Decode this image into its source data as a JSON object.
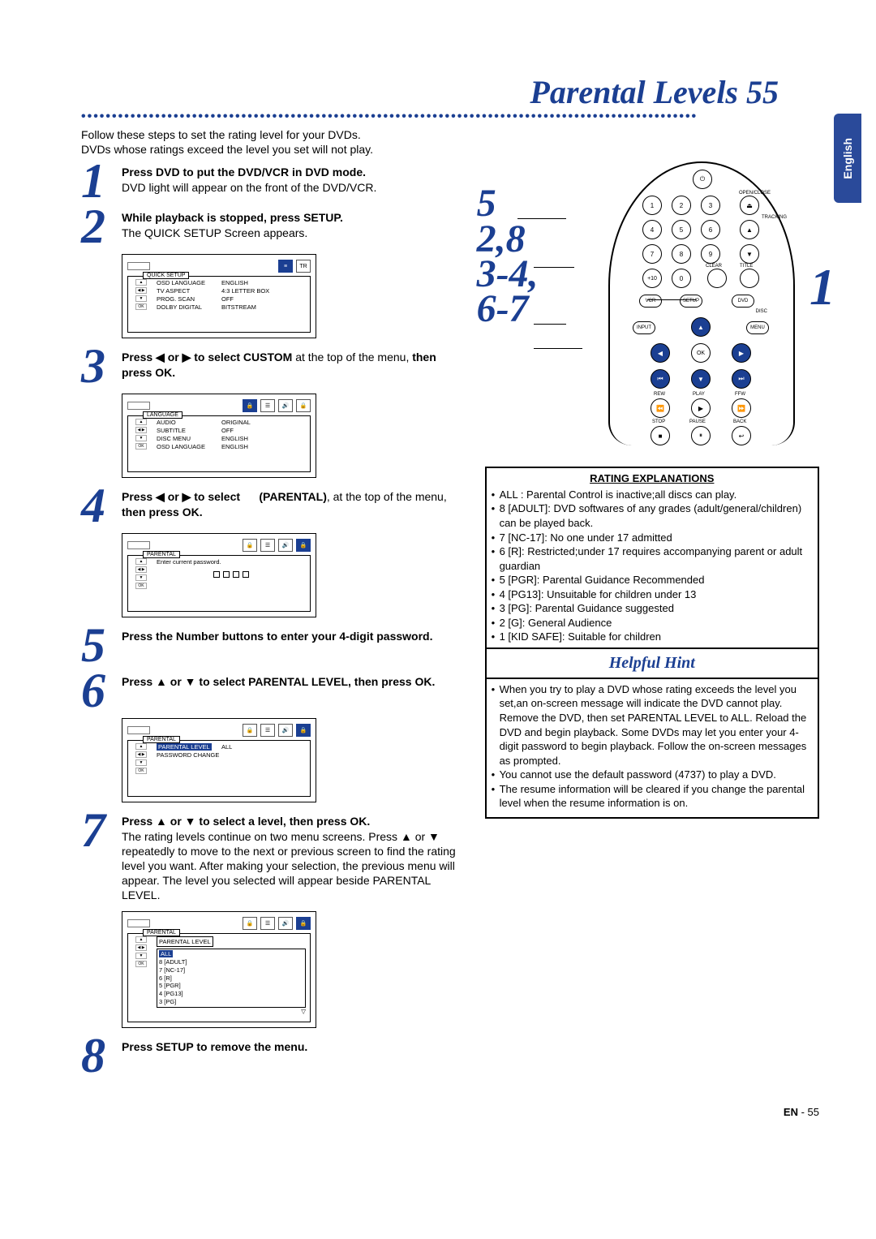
{
  "page": {
    "title_text": "Parental Levels",
    "title_num": "55",
    "footer_prefix": "EN",
    "footer_num": "55"
  },
  "lang_tab": "English",
  "intro": {
    "line1": "Follow these steps to set the rating level for your DVDs.",
    "line2": "DVDs whose ratings exceed the level you set will not play."
  },
  "steps": {
    "s1": {
      "num": "1",
      "bold": "Press DVD to put the DVD/VCR in DVD mode.",
      "rest": "DVD light will appear on the front of the DVD/VCR."
    },
    "s2": {
      "num": "2",
      "bold": "While playback is stopped, press SETUP.",
      "rest": "The QUICK SETUP Screen appears."
    },
    "s3": {
      "num": "3",
      "t1": "Press ◀ or ▶ to select CUSTOM",
      "t2": " at the top of the menu, ",
      "t3": "then press OK."
    },
    "s4": {
      "num": "4",
      "t1": "Press ◀ or ▶ to select",
      "mid": "(PARENTAL)",
      "t2": ", at the top of the menu, ",
      "t3": "then press OK."
    },
    "s5": {
      "num": "5",
      "bold": "Press the Number buttons to enter your 4-digit password."
    },
    "s6": {
      "num": "6",
      "bold": "Press ▲ or ▼ to select PARENTAL LEVEL, then press OK."
    },
    "s7": {
      "num": "7",
      "bold": "Press ▲ or ▼ to select a level, then press OK.",
      "rest": "The rating levels continue on two menu screens. Press ▲ or ▼ repeatedly to move to the next or previous screen to find the rating level you want. After making your selection, the previous menu will appear. The level you selected will appear beside PARENTAL LEVEL."
    },
    "s8": {
      "num": "8",
      "bold": "Press SETUP to remove the menu."
    }
  },
  "osd": {
    "quick": {
      "header": "QUICK SETUP",
      "rows": [
        {
          "k": "OSD LANGUAGE",
          "v": "ENGLISH"
        },
        {
          "k": "TV ASPECT",
          "v": "4:3 LETTER BOX"
        },
        {
          "k": "PROG. SCAN",
          "v": "OFF"
        },
        {
          "k": "DOLBY DIGITAL",
          "v": "BITSTREAM"
        }
      ]
    },
    "lang": {
      "header": "LANGUAGE",
      "rows": [
        {
          "k": "AUDIO",
          "v": "ORIGINAL"
        },
        {
          "k": "SUBTITLE",
          "v": "OFF"
        },
        {
          "k": "DISC MENU",
          "v": "ENGLISH"
        },
        {
          "k": "OSD LANGUAGE",
          "v": "ENGLISH"
        }
      ]
    },
    "parental_pw": {
      "header": "PARENTAL",
      "msg": "Enter current password."
    },
    "parental_level": {
      "header": "PARENTAL",
      "row1_k": "PARENTAL LEVEL",
      "row1_v": "ALL",
      "row2": "PASSWORD CHANGE"
    },
    "parental_list": {
      "header": "PARENTAL",
      "title": "PARENTAL LEVEL",
      "items": [
        "ALL",
        "8 [ADULT]",
        "7 [NC-17]",
        "6 [R]",
        "5 [PGR]",
        "4 [PG13]",
        "3 [PG]"
      ]
    },
    "ok_btn": "OK"
  },
  "remote": {
    "side": [
      "5",
      "2,8",
      "3-4,",
      "6-7"
    ],
    "right1": "1",
    "labels": {
      "open": "OPEN/CLOSE",
      "tracking": "TRACKING",
      "clear": "CLEAR",
      "title": "TITLE",
      "vcr": "VCR",
      "setup": "SETUP",
      "dvd": "DVD",
      "disc": "DISC",
      "menu": "MENU",
      "input": "INPUT",
      "ok": "OK",
      "rew": "REW",
      "play": "PLAY",
      "ffw": "FFW",
      "stop": "STOP",
      "pause": "PAUSE",
      "back": "BACK"
    },
    "nums": [
      "1",
      "2",
      "3",
      "4",
      "5",
      "6",
      "7",
      "8",
      "9",
      "0"
    ],
    "plus10": "+10"
  },
  "rating_box": {
    "title": "RATING EXPLANATIONS",
    "items": [
      "ALL : Parental Control is inactive;all discs can play.",
      "8 [ADULT]: DVD softwares of any grades (adult/general/children) can be played back.",
      "7 [NC-17]: No one under 17 admitted",
      "6 [R]: Restricted;under 17 requires accompanying parent or adult guardian",
      "5 [PGR]: Parental Guidance Recommended",
      "4 [PG13]: Unsuitable for children under 13",
      "3 [PG]: Parental Guidance suggested",
      "2 [G]: General Audience",
      "1 [KID SAFE]: Suitable for children"
    ]
  },
  "hint_box": {
    "title": "Helpful Hint",
    "items": [
      "When you try to play a DVD whose rating exceeds the level you set,an on-screen message will indicate the DVD cannot play. Remove the DVD, then set PARENTAL LEVEL to ALL. Reload the DVD and begin playback. Some DVDs may let you enter your 4-digit password to begin playback. Follow the on-screen messages as prompted.",
      "You cannot use the default password (4737) to play a DVD.",
      "The resume information will be cleared if you change the parental level when the resume information is on."
    ]
  }
}
